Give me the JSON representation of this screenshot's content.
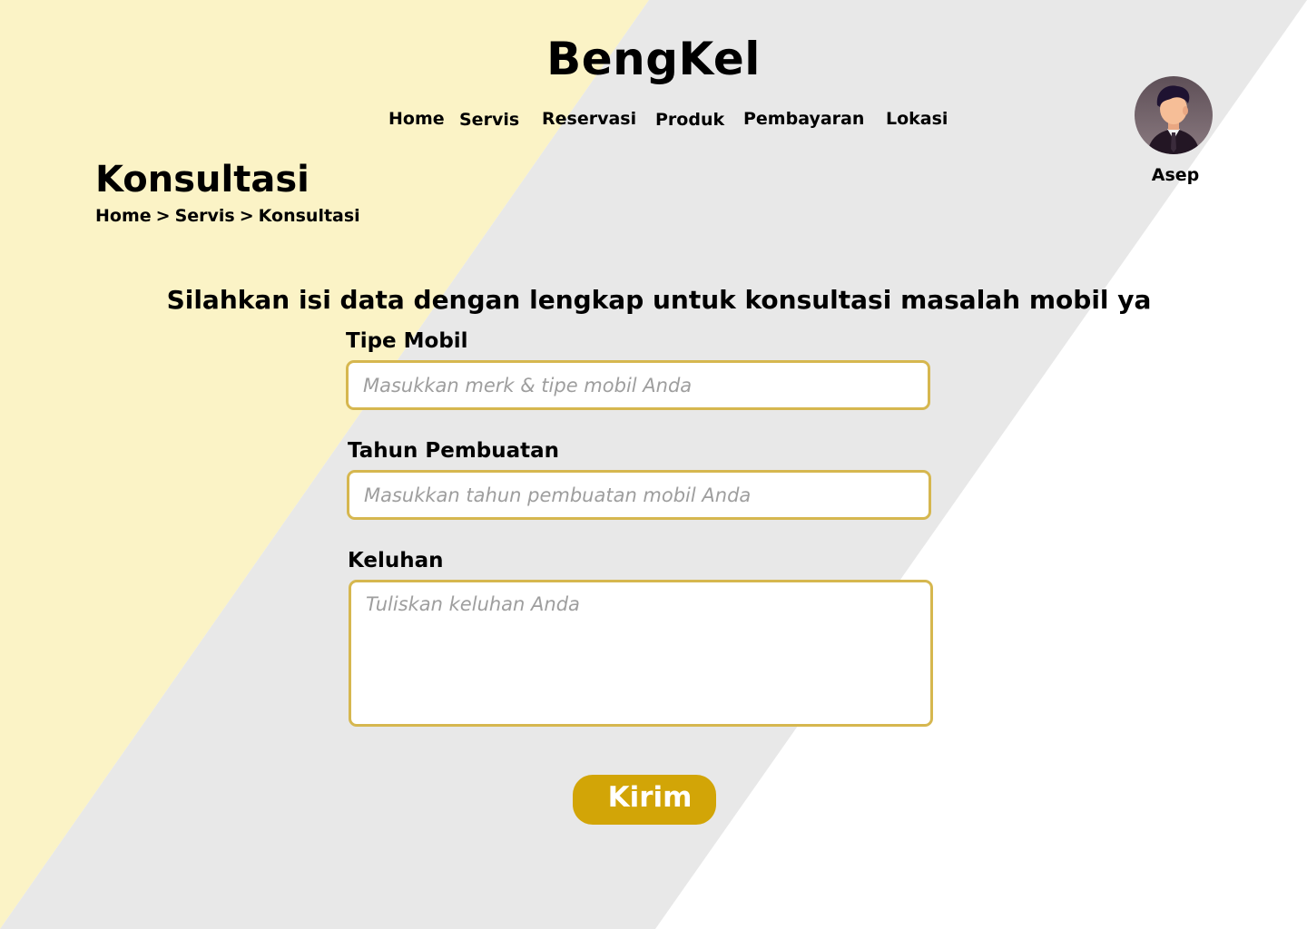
{
  "brand": {
    "title": "BengKel"
  },
  "nav": {
    "items": [
      {
        "label": "Home"
      },
      {
        "label": "Servis"
      },
      {
        "label": "Reservasi"
      },
      {
        "label": "Produk"
      },
      {
        "label": "Pembayaran"
      },
      {
        "label": "Lokasi"
      }
    ]
  },
  "user": {
    "name": "Asep",
    "avatar_icon": "user-avatar-icon"
  },
  "page": {
    "title": "Konsultasi",
    "breadcrumb": {
      "items": [
        "Home",
        "Servis",
        "Konsultasi"
      ],
      "separator": ">"
    }
  },
  "form": {
    "intro": "Silahkan isi data dengan lengkap untuk konsultasi masalah mobil ya",
    "fields": [
      {
        "label": "Tipe Mobil",
        "placeholder": "Masukkan merk & tipe mobil Anda",
        "value": ""
      },
      {
        "label": "Tahun Pembuatan",
        "placeholder": "Masukkan tahun pembuatan mobil Anda",
        "value": ""
      },
      {
        "label": "Keluhan",
        "placeholder": "Tuliskan keluhan Anda",
        "value": ""
      }
    ],
    "submit_label": "Kirim"
  },
  "colors": {
    "bg_yellow": "#fbf3c6",
    "bg_gray": "#e8e8e8",
    "bg_white": "#ffffff",
    "field_border": "#d6b74f",
    "button": "#d2a507",
    "button_text": "#ffffff",
    "placeholder": "#9e9e9e"
  }
}
